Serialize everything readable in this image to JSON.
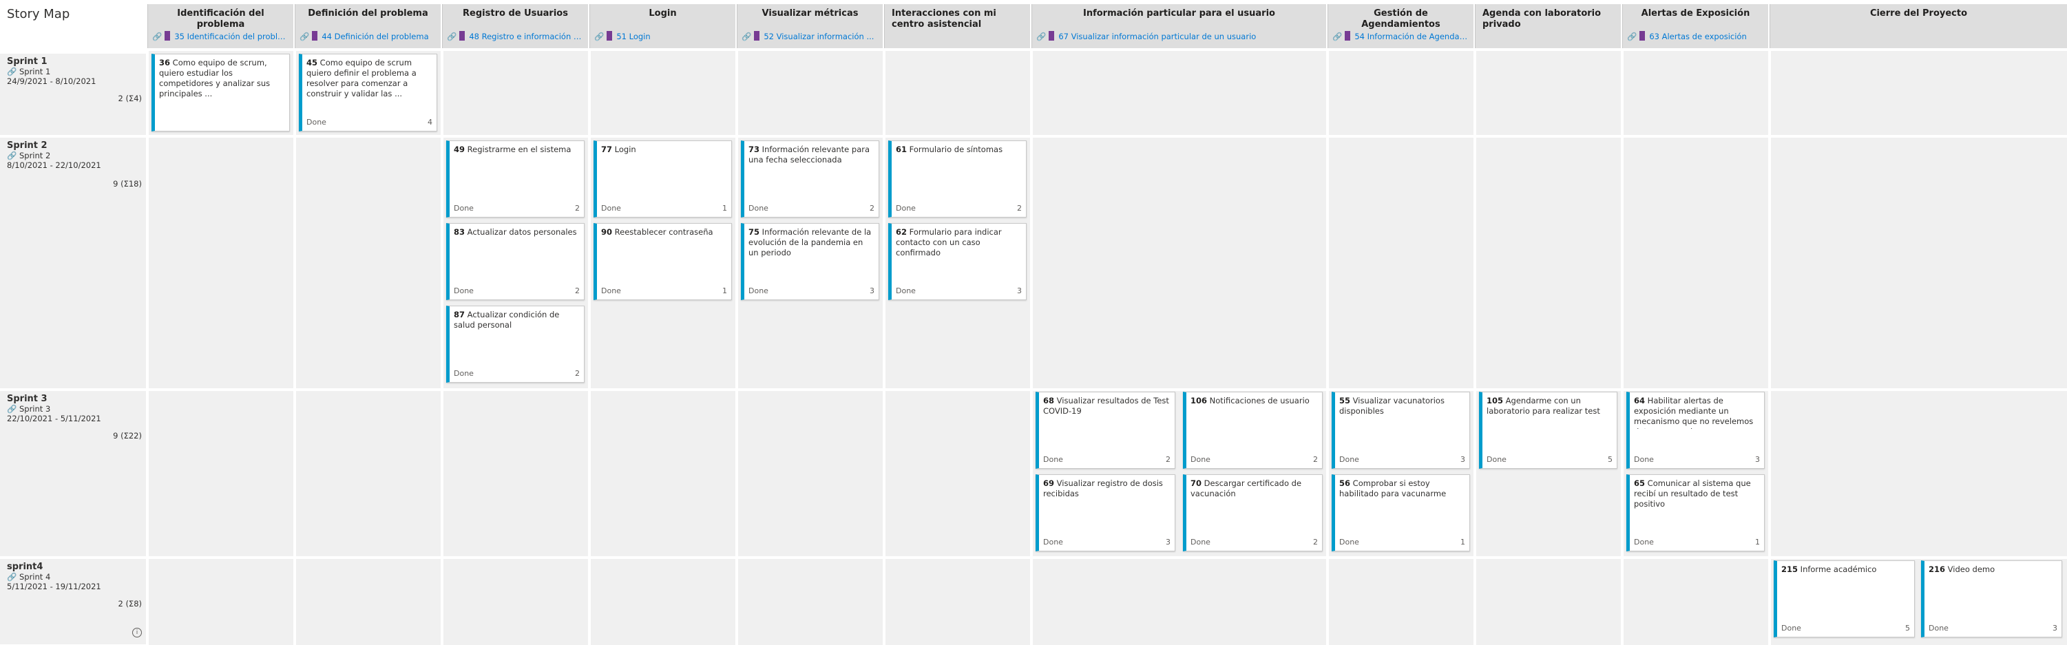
{
  "title": "Story Map",
  "columns": [
    {
      "title": "Identificación del problema",
      "link": "35 Identificación del problema"
    },
    {
      "title": "Definición del problema",
      "link": "44 Definición del problema"
    },
    {
      "title": "Registro de Usuarios",
      "link": "48 Registro e información de ..."
    },
    {
      "title": "Login",
      "link": "51 Login"
    },
    {
      "title": "Visualizar métricas",
      "link": "52 Visualizar información ..."
    },
    {
      "title": "Interacciones con mi centro asistencial",
      "link": ""
    },
    {
      "title": "Información particular para el usuario",
      "link": "67 Visualizar información particular de un usuario"
    },
    {
      "title": "Gestión de Agendamientos",
      "link": "54 Información de Agenda ..."
    },
    {
      "title": "Agenda con laboratorio privado",
      "link": ""
    },
    {
      "title": "Alertas de Exposición",
      "link": "63 Alertas de exposición"
    },
    {
      "title": "Cierre del Proyecto",
      "link": ""
    }
  ],
  "sprints": [
    {
      "name": "Sprint 1",
      "link": "Sprint 1",
      "dates": "24/9/2021 - 8/10/2021",
      "count": "2 (Σ4)"
    },
    {
      "name": "Sprint 2",
      "link": "Sprint 2",
      "dates": "8/10/2021 - 22/10/2021",
      "count": "9 (Σ18)"
    },
    {
      "name": "Sprint 3",
      "link": "Sprint 3",
      "dates": "22/10/2021 - 5/11/2021",
      "count": "9 (Σ22)"
    },
    {
      "name": "sprint4",
      "link": "Sprint 4",
      "dates": "5/11/2021 - 19/11/2021",
      "count": "2 (Σ8)"
    }
  ],
  "cards": {
    "c36": {
      "id": "36",
      "title": "Como equipo de scrum, quiero estudiar los competidores y analizar sus principales ...",
      "state": "",
      "points": ""
    },
    "c45": {
      "id": "45",
      "title": "Como equipo de scrum quiero definir el problema a resolver para comenzar a construir y validar las ...",
      "state": "Done",
      "points": "4"
    },
    "c49": {
      "id": "49",
      "title": "Registrarme en el sistema",
      "state": "Done",
      "points": "2"
    },
    "c83": {
      "id": "83",
      "title": "Actualizar datos personales",
      "state": "Done",
      "points": "2"
    },
    "c87": {
      "id": "87",
      "title": "Actualizar condición de salud personal",
      "state": "Done",
      "points": "2"
    },
    "c77": {
      "id": "77",
      "title": "Login",
      "state": "Done",
      "points": "1"
    },
    "c90": {
      "id": "90",
      "title": "Reestablecer contraseña",
      "state": "Done",
      "points": "1"
    },
    "c73": {
      "id": "73",
      "title": "Información relevante para una fecha seleccionada",
      "state": "Done",
      "points": "2"
    },
    "c75": {
      "id": "75",
      "title": "Información relevante de la evolución de la pandemia en un periodo",
      "state": "Done",
      "points": "3"
    },
    "c61": {
      "id": "61",
      "title": "Formulario de síntomas",
      "state": "Done",
      "points": "2"
    },
    "c62": {
      "id": "62",
      "title": "Formulario para indicar contacto con un caso confirmado",
      "state": "Done",
      "points": "3"
    },
    "c68": {
      "id": "68",
      "title": "Visualizar resultados de Test COVID-19",
      "state": "Done",
      "points": "2"
    },
    "c106": {
      "id": "106",
      "title": "Notificaciones de usuario",
      "state": "Done",
      "points": "2"
    },
    "c69": {
      "id": "69",
      "title": "Visualizar registro de dosis recibidas",
      "state": "Done",
      "points": "3"
    },
    "c70": {
      "id": "70",
      "title": "Descargar certificado de vacunación",
      "state": "Done",
      "points": "2"
    },
    "c55": {
      "id": "55",
      "title": "Visualizar vacunatorios disponibles",
      "state": "Done",
      "points": "3"
    },
    "c56": {
      "id": "56",
      "title": "Comprobar si estoy habilitado para vacunarme",
      "state": "Done",
      "points": "1"
    },
    "c105": {
      "id": "105",
      "title": "Agendarme con un laboratorio para realizar test",
      "state": "Done",
      "points": "5"
    },
    "c64": {
      "id": "64",
      "title": "Habilitar alertas de exposición mediante un mecanismo que no revelemos datos personales",
      "state": "Done",
      "points": "3"
    },
    "c65": {
      "id": "65",
      "title": "Comunicar al sistema que recibí un resultado de test positivo",
      "state": "Done",
      "points": "1"
    },
    "c215": {
      "id": "215",
      "title": "Informe académico",
      "state": "Done",
      "points": "5"
    },
    "c216": {
      "id": "216",
      "title": "Video demo",
      "state": "Done",
      "points": "3"
    }
  },
  "colors": {
    "accent": "#009ccc",
    "epic": "#773b93",
    "link": "#0078d4",
    "header_bg": "#dedede",
    "cell_bg": "#f0f0f0"
  }
}
